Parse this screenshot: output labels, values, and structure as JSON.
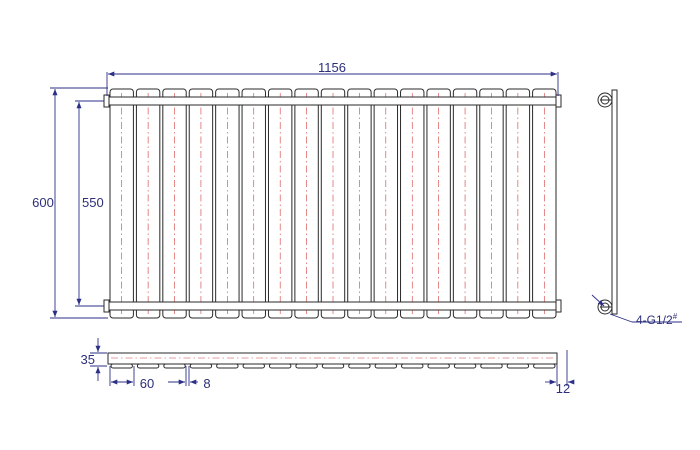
{
  "drawing": {
    "overall_width_label": "1156",
    "overall_height_label": "600",
    "pipe_centers_label": "550",
    "depth_label": "35",
    "column_width_label": "60",
    "column_gap_label": "8",
    "side_offset_label": "12",
    "connection_label": "4-G1/2",
    "connection_mark": "#",
    "column_count": 17
  },
  "colors": {
    "dimension": "#2b2f86",
    "outline": "#2a2a2a",
    "centerline": "#d23a3a"
  }
}
